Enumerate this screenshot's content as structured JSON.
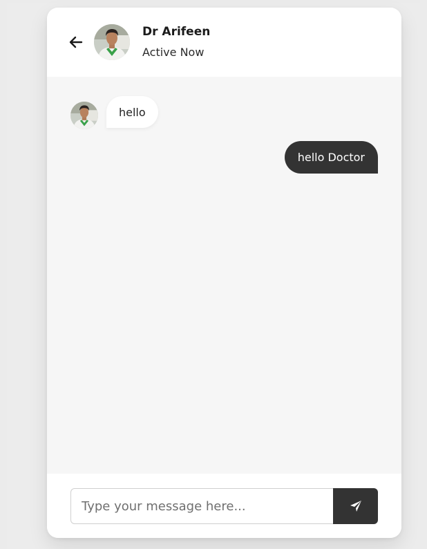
{
  "header": {
    "name": "Dr Arifeen",
    "status": "Active Now",
    "back_icon": "arrow-left-icon",
    "avatar_icon": "doctor-avatar"
  },
  "messages": [
    {
      "direction": "incoming",
      "text": "hello"
    },
    {
      "direction": "outgoing",
      "text": "hello Doctor"
    }
  ],
  "composer": {
    "placeholder": "Type your message here...",
    "value": "",
    "send_icon": "paper-plane-icon"
  },
  "colors": {
    "page_background": "#ebebeb",
    "chat_background": "#f6f6f6",
    "outgoing_bubble": "#333333",
    "incoming_bubble": "#ffffff",
    "send_button": "#333333"
  }
}
